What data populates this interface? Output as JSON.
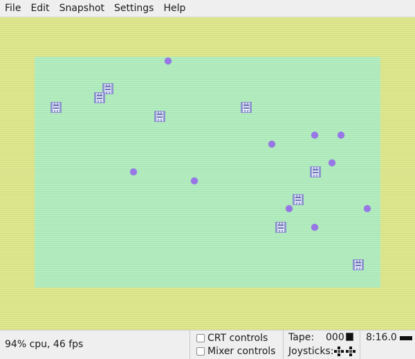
{
  "menu": {
    "file": "File",
    "edit": "Edit",
    "snapshot": "Snapshot",
    "settings": "Settings",
    "help": "Help"
  },
  "screen": {
    "border_color": "#dfe88e",
    "paper_color": "#b3eec0",
    "ball_color": "#9a78ea",
    "sprite_icon": "checker-block-icon",
    "ball_count": 11,
    "block_count": 9
  },
  "status": {
    "perf": "94% cpu, 46 fps",
    "crt_controls": "CRT controls",
    "crt_checked": false,
    "mixer_controls": "Mixer controls",
    "mixer_checked": false,
    "tape_label": "Tape:",
    "tape_counter": "000",
    "joysticks_label": "Joysticks:",
    "clock": "8:16.0"
  }
}
